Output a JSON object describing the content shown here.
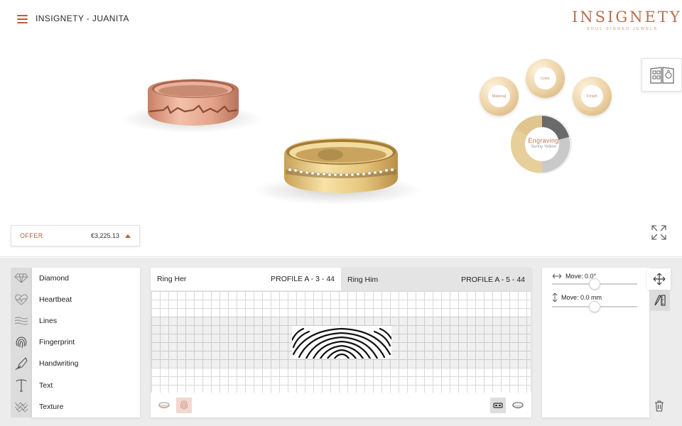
{
  "header": {
    "title": "INSIGNETY - JUANITA",
    "menu_icon": "hamburger-icon",
    "brand_name": "INSIGNETY",
    "brand_tagline": "SOUL SIGNED JEWELS",
    "catalog_icon": "catalog-book-icon"
  },
  "config_wheel": {
    "material": "Material",
    "color": "Color",
    "finish": "Finish",
    "engraving_title": "Engraving",
    "engraving_value": "Sunny Yellow"
  },
  "offer": {
    "label": "OFFER",
    "price": "€3,225.13",
    "caret_icon": "caret-up-icon"
  },
  "expand_icon": "expand-arrows-icon",
  "tools": [
    {
      "label": "Diamond",
      "icon": "diamond-icon"
    },
    {
      "label": "Heartbeat",
      "icon": "heartbeat-icon"
    },
    {
      "label": "Lines",
      "icon": "lines-icon"
    },
    {
      "label": "Fingerprint",
      "icon": "fingerprint-icon"
    },
    {
      "label": "Handwriting",
      "icon": "pen-nib-icon"
    },
    {
      "label": "Text",
      "icon": "text-icon"
    },
    {
      "label": "Texture",
      "icon": "texture-icon"
    }
  ],
  "ring_tabs": {
    "her_label": "Ring Her",
    "her_profile": "PROFILE A - 3 - 44",
    "him_label": "Ring Him",
    "him_profile": "PROFILE A - 5 - 44"
  },
  "properties": {
    "rotate_label": "Move: 0.0°",
    "rotate_value": 0.5,
    "vertical_label": "Move: 0.0 mm",
    "vertical_value": 0.5
  },
  "colors": {
    "accent": "#b85c3c",
    "brand": "#b5714f",
    "gold": "#e3c27e",
    "rose": "#d99880",
    "panel_bg": "#ececec"
  }
}
